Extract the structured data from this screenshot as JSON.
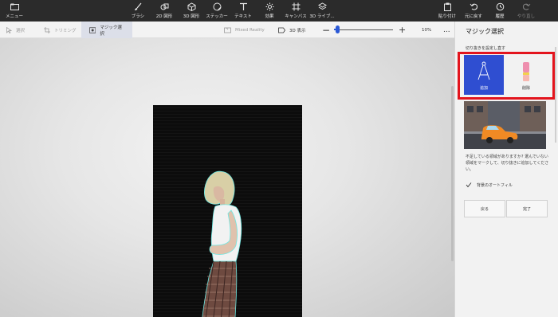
{
  "toolbar": {
    "menu": {
      "label": "メニュー",
      "icon": "folder-icon"
    },
    "items": [
      {
        "label": "ブラシ",
        "icon": "brush-icon"
      },
      {
        "label": "2D 図形",
        "icon": "shapes-2d-icon"
      },
      {
        "label": "3D 図形",
        "icon": "cube-icon"
      },
      {
        "label": "ステッカー",
        "icon": "sticker-icon"
      },
      {
        "label": "テキスト",
        "icon": "text-icon"
      },
      {
        "label": "効果",
        "icon": "effects-icon"
      },
      {
        "label": "キャンバス",
        "icon": "canvas-icon"
      },
      {
        "label": "3D ライブ...",
        "icon": "library-3d-icon"
      }
    ],
    "right": [
      {
        "label": "貼り付け",
        "icon": "paste-icon"
      },
      {
        "label": "元に戻す",
        "icon": "undo-icon"
      },
      {
        "label": "履歴",
        "icon": "history-icon"
      },
      {
        "label": "やり直し",
        "icon": "redo-icon"
      }
    ]
  },
  "subtoolbar": {
    "select": "選択",
    "crop": "トリミング",
    "magic_select": "マジック選択",
    "mixed_reality": "Mixed Reality",
    "view_3d": "3D 表示",
    "zoom_value": "10%",
    "zoom_level": 0.06,
    "more": "..."
  },
  "panel": {
    "title": "マジック選択",
    "subtitle": "切り抜きを設定し直す",
    "add_label": "追加",
    "remove_label": "削除",
    "hint": "不足している領域がありますか? 選んでいない領域をマークして、切り抜きに追加してください。",
    "autofill_label": "背景のオートフィル",
    "autofill_checked": true,
    "back_button": "戻る",
    "done_button": "完了"
  },
  "colors": {
    "accent": "#2f4ed1",
    "highlight": "#e3141d",
    "toolbar_bg": "#2b2b2b"
  }
}
